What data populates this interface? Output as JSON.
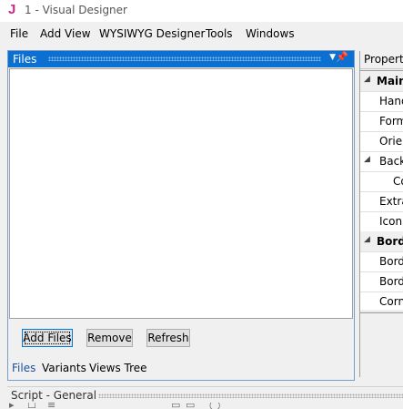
{
  "window": {
    "app_icon_letter": "J",
    "title": "1 - Visual Designer"
  },
  "menu": [
    "File",
    "Add View",
    "WYSIWYG Designer",
    "Tools",
    "Windows"
  ],
  "files_panel": {
    "title": "Files",
    "buttons": {
      "add": "Add Files",
      "remove": "Remove",
      "refresh": "Refresh"
    },
    "tabs": [
      "Files",
      "Variants",
      "Views Tree"
    ]
  },
  "properties": {
    "title": "Propertie",
    "rows": [
      {
        "label": "Main",
        "category": true
      },
      {
        "label": "Hand"
      },
      {
        "label": "Form"
      },
      {
        "label": "Orier"
      },
      {
        "label": "Back"
      },
      {
        "label": "Co"
      },
      {
        "label": "Extra"
      },
      {
        "label": "Icon"
      },
      {
        "label": "Borde",
        "category": true
      },
      {
        "label": "Bord"
      },
      {
        "label": "Bord"
      },
      {
        "label": "Corn"
      }
    ]
  },
  "script_panel": {
    "title": "Script - General"
  },
  "colors": {
    "accent": "#0b70d1",
    "app_icon": "#cc2a8a"
  }
}
